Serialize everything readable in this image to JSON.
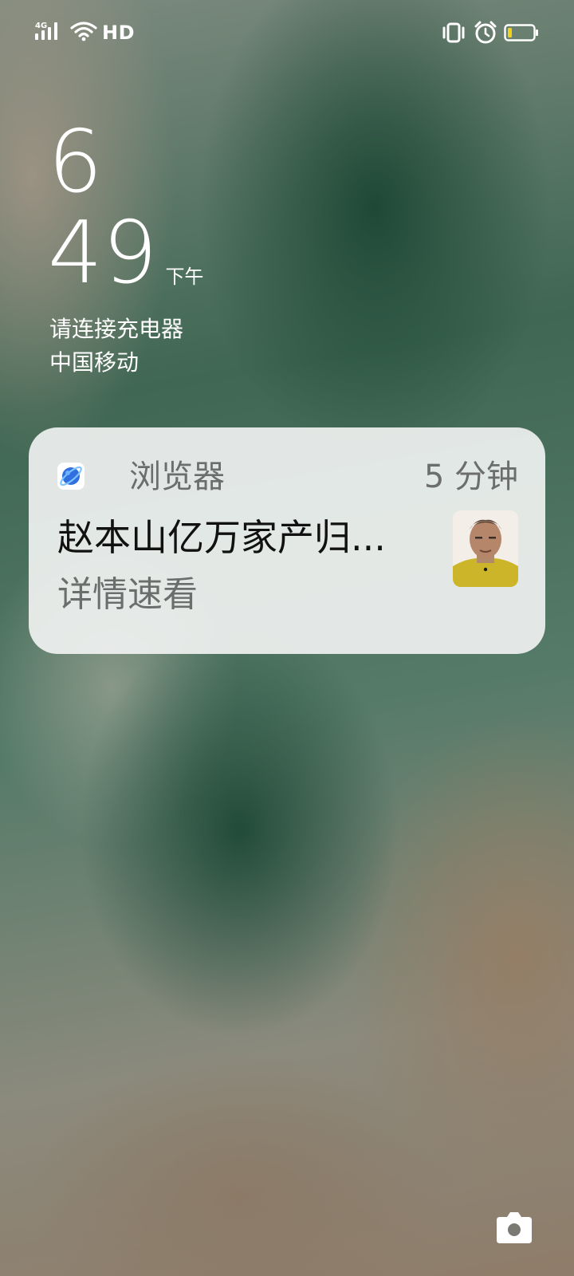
{
  "status_bar": {
    "network_type": "4G",
    "hd_label": "HD",
    "icons": [
      "cellular-signal-icon",
      "wifi-icon",
      "vibrate-icon",
      "alarm-icon",
      "battery-low-icon"
    ]
  },
  "lock_screen": {
    "clock_hour": "6",
    "clock_minute": "49",
    "ampm": "下午",
    "charge_hint": "请连接充电器",
    "carrier": "中国移动"
  },
  "notification": {
    "app_name": "浏览器",
    "time": "5 分钟",
    "title": "赵本山亿万家产归...",
    "body": "详情速看"
  },
  "shortcuts": {
    "camera_icon": "camera-icon"
  },
  "colors": {
    "card_bg": "#f0f2f1",
    "secondary_text": "#6b6e6c",
    "battery_low": "#f2d11b"
  }
}
